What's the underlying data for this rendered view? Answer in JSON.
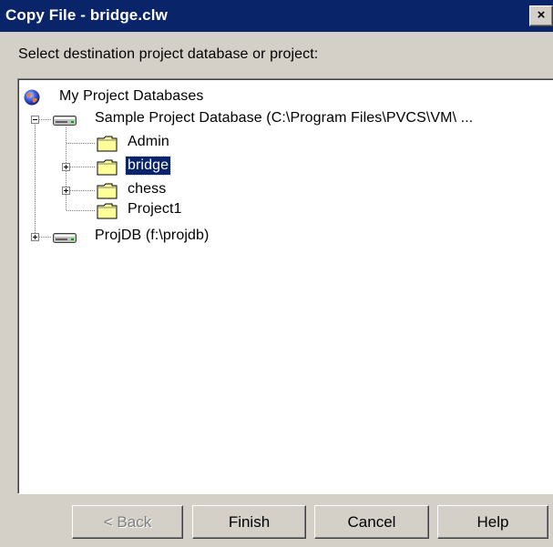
{
  "window": {
    "title": "Copy File - bridge.clw",
    "close_glyph": "×"
  },
  "instruction": "Select destination project database or project:",
  "tree": {
    "root": {
      "label": "My Project Databases",
      "icon": "globe-icon"
    },
    "databases": [
      {
        "label": "Sample Project Database (C:\\Program Files\\PVCS\\VM\\ ...",
        "icon": "drive-icon",
        "expanded": true,
        "projects": [
          {
            "label": "Admin",
            "icon": "folder-icon",
            "has_children": false,
            "selected": false
          },
          {
            "label": "bridge",
            "icon": "folder-icon",
            "has_children": true,
            "selected": true
          },
          {
            "label": "chess",
            "icon": "folder-icon",
            "has_children": true,
            "selected": false
          },
          {
            "label": "Project1",
            "icon": "folder-icon",
            "has_children": false,
            "selected": false
          }
        ]
      },
      {
        "label": "ProjDB (f:\\projdb)",
        "icon": "drive-icon",
        "expanded": false,
        "projects": []
      }
    ]
  },
  "buttons": {
    "back": {
      "label": "< Back",
      "enabled": false
    },
    "finish": {
      "label": "Finish",
      "enabled": true
    },
    "cancel": {
      "label": "Cancel",
      "enabled": true
    },
    "help": {
      "label": "Help",
      "enabled": true
    }
  },
  "colors": {
    "title_bar": "#0a246a",
    "face": "#d4d0c8",
    "selection": "#0a246a",
    "folder": "#ffff99"
  }
}
